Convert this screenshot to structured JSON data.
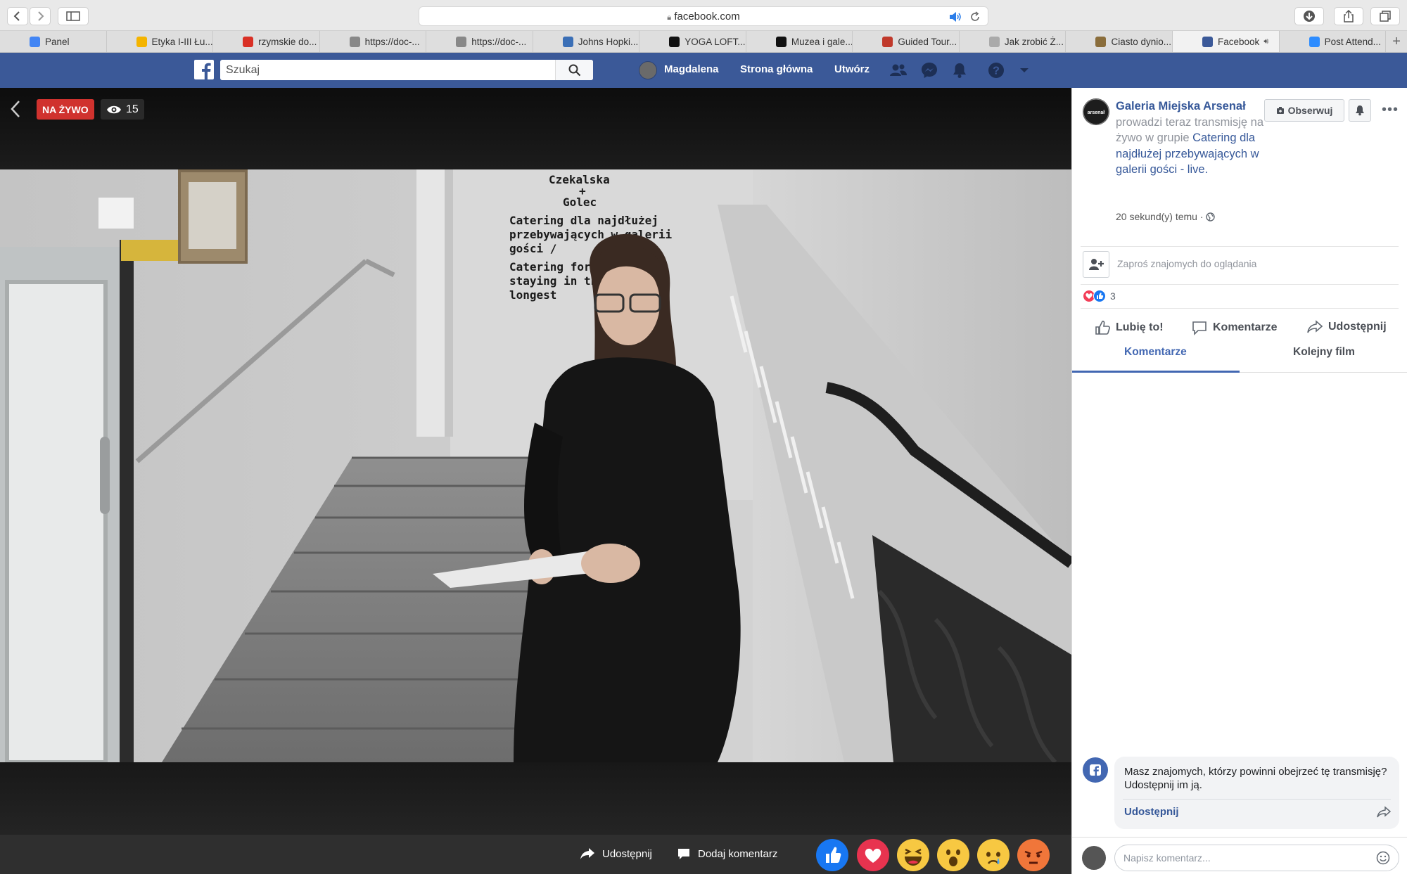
{
  "browser": {
    "url": "facebook.com",
    "tabs": [
      {
        "label": "Panel",
        "color": "#4285f4"
      },
      {
        "label": "Etyka I-III Łu...",
        "color": "#f4b400"
      },
      {
        "label": "rzymskie do...",
        "color": "#d93025"
      },
      {
        "label": "https://doc-...",
        "color": "#888888"
      },
      {
        "label": "https://doc-...",
        "color": "#888888"
      },
      {
        "label": "Johns Hopki...",
        "color": "#3b6fb6"
      },
      {
        "label": "YOGA LOFT...",
        "color": "#111111"
      },
      {
        "label": "Muzea i gale...",
        "color": "#111111"
      },
      {
        "label": "Guided Tour...",
        "color": "#c0392b"
      },
      {
        "label": "Jak zrobić Ż...",
        "color": "#aaaaaa"
      },
      {
        "label": "Ciasto dynio...",
        "color": "#8a6d3b"
      },
      {
        "label": "Facebook",
        "color": "#3b5998",
        "active": true
      },
      {
        "label": "Post Attend...",
        "color": "#2d8cff"
      }
    ]
  },
  "facebook": {
    "search_placeholder": "Szukaj",
    "user_name": "Magdalena",
    "home": "Strona główna",
    "create": "Utwórz"
  },
  "video": {
    "live_label": "NA ŻYWO",
    "viewers": "15",
    "wall_text": {
      "names": [
        "Czekalska",
        "+",
        "Golec"
      ],
      "lines": [
        "Catering dla najdłużej",
        "przebywających w galerii",
        "gości /",
        "Catering for the vi",
        "staying in the g",
        "longest"
      ]
    },
    "controls": {
      "share": "Udostępnij",
      "comment": "Dodaj komentarz"
    }
  },
  "panel": {
    "page_name": "Galeria Miejska Arsenał",
    "streaming_text": " prowadzi teraz transmisję na żywo w grupie ",
    "group_name": "Catering dla najdłużej przebywających w galerii gości - live.",
    "time": "20 sekund(y) temu · ",
    "follow": "Obserwuj",
    "invite": "Zaproś znajomych do oglądania",
    "reaction_count": "3",
    "like": "Lubię to!",
    "comments": "Komentarze",
    "share": "Udostępnij",
    "tab_comments": "Komentarze",
    "tab_next": "Kolejny film",
    "share_prompt": "Masz znajomych, którzy powinni obejrzeć tę transmisję? Udostępnij im ją.",
    "share_link": "Udostępnij",
    "comment_placeholder": "Napisz komentarz..."
  },
  "colors": {
    "facebook_blue": "#3b5998",
    "live_red": "#d0322e",
    "link_blue": "#365899"
  }
}
